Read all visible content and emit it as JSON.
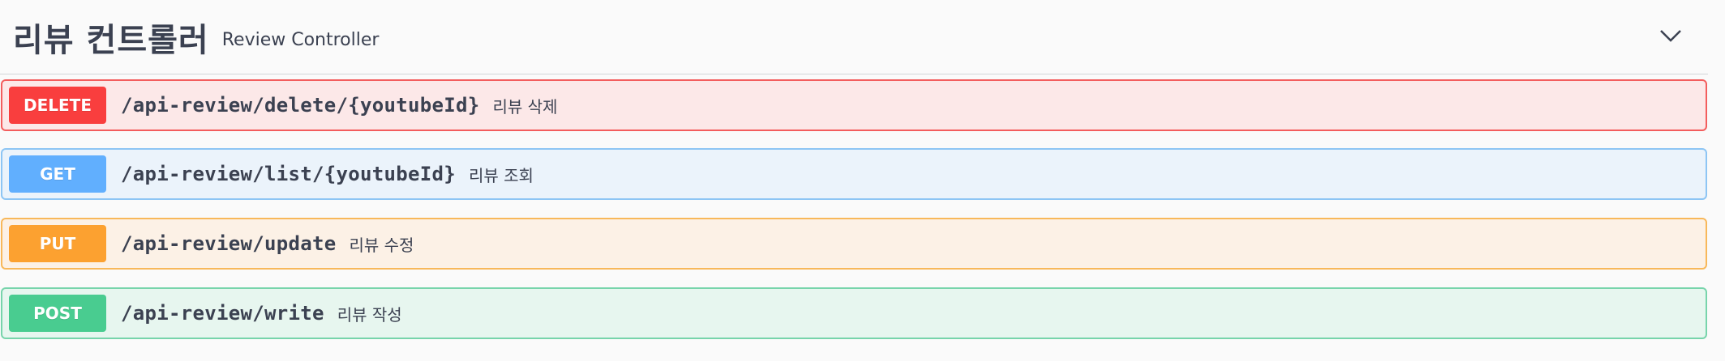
{
  "tag": {
    "title": "리뷰 컨트롤러",
    "description": "Review Controller",
    "chevron_icon": "chevron-down-icon"
  },
  "operations": [
    {
      "method": "DELETE",
      "path": "/api-review/delete/{youtubeId}",
      "summary": "리뷰 삭제",
      "color": "#f93e3e"
    },
    {
      "method": "GET",
      "path": "/api-review/list/{youtubeId}",
      "summary": "리뷰 조회",
      "color": "#61affe"
    },
    {
      "method": "PUT",
      "path": "/api-review/update",
      "summary": "리뷰 수정",
      "color": "#fca130"
    },
    {
      "method": "POST",
      "path": "/api-review/write",
      "summary": "리뷰 작성",
      "color": "#49cc90"
    }
  ]
}
